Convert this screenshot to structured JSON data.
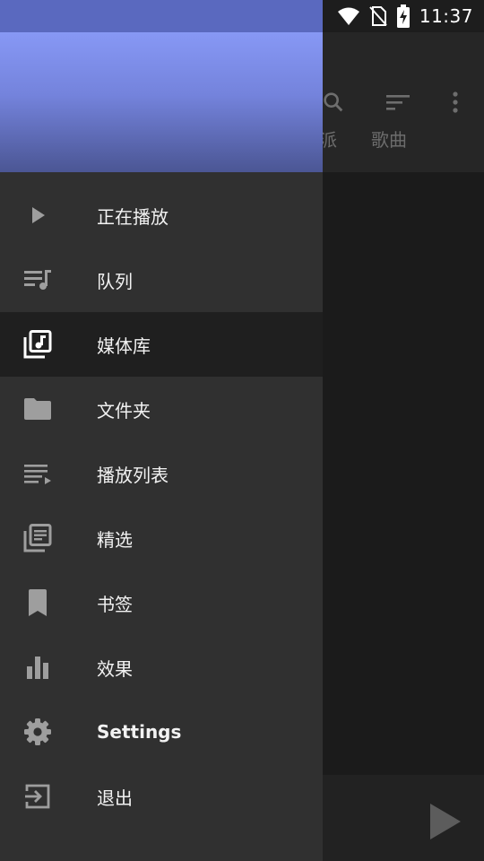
{
  "status_bar": {
    "time": "11:37",
    "icons": [
      "wifi-icon",
      "no-sim-icon",
      "battery-charging-icon"
    ]
  },
  "background_app": {
    "toolbar_icons": [
      "search-icon",
      "sort-icon",
      "more-vert-icon"
    ],
    "tabs": [
      {
        "label": "派"
      },
      {
        "label": "歌曲"
      }
    ],
    "miniplayer": {
      "icon": "play-icon"
    }
  },
  "drawer": {
    "items": [
      {
        "label": "正在播放",
        "icon": "play-arrow-icon",
        "active": false
      },
      {
        "label": "队列",
        "icon": "queue-music-icon",
        "active": false
      },
      {
        "label": "媒体库",
        "icon": "library-music-icon",
        "active": true
      },
      {
        "label": "文件夹",
        "icon": "folder-icon",
        "active": false
      },
      {
        "label": "播放列表",
        "icon": "playlist-play-icon",
        "active": false
      },
      {
        "label": "精选",
        "icon": "library-books-icon",
        "active": false
      },
      {
        "label": "书签",
        "icon": "bookmark-icon",
        "active": false
      },
      {
        "label": "效果",
        "icon": "equalizer-icon",
        "active": false
      },
      {
        "label": "Settings",
        "icon": "settings-gear-icon",
        "active": false
      },
      {
        "label": "退出",
        "icon": "exit-icon",
        "active": false
      }
    ]
  },
  "colors": {
    "drawer_bg": "#303030",
    "active_item_bg": "#1f1f1f",
    "header_top": "#8798f5",
    "header_bottom": "#4b5694",
    "icon": "#9e9e9e",
    "icon_active": "#ffffff"
  }
}
